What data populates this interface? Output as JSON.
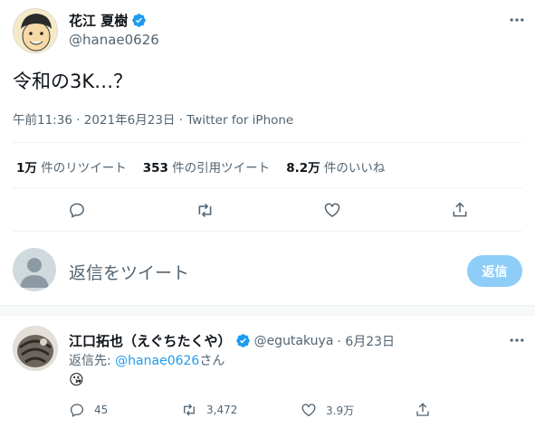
{
  "tweet": {
    "author_name": "花江 夏樹",
    "author_handle": "@hanae0626",
    "text": "令和の3K…？",
    "timestamp": "午前11:36 · 2021年6月23日 · ",
    "source": "Twitter for iPhone",
    "stats": [
      {
        "num": "1万",
        "label": " 件のリツイート"
      },
      {
        "num": "353",
        "label": " 件の引用ツイート"
      },
      {
        "num": "8.2万",
        "label": " 件のいいね"
      }
    ],
    "actions": [
      "reply-icon",
      "retweet-icon",
      "like-icon",
      "share-icon"
    ],
    "more_icon": "more-icon"
  },
  "compose": {
    "placeholder": "返信をツイート",
    "reply_button": "返信"
  },
  "reply": {
    "author_name": "江口拓也（えぐちたくや）",
    "author_handle": "@egutakuya",
    "date": " · 6月23日",
    "reply_to_prefix": "返信先: ",
    "reply_to_handle": "@hanae0626",
    "reply_to_suffix": "さん",
    "emoji": "😘",
    "counts": {
      "reply": "45",
      "retweet": "3,472",
      "like": "3.9万"
    }
  },
  "colors": {
    "accent": "#1d9bf0",
    "accent_disabled": "#8ecdf8",
    "text": "#0f1419",
    "muted": "#536471",
    "verified": "#1d9bf0"
  }
}
